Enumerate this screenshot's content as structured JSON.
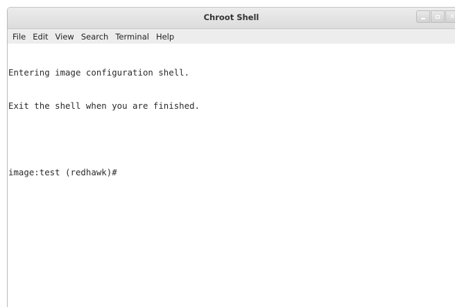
{
  "window": {
    "title": "Chroot Shell"
  },
  "menubar": {
    "items": [
      {
        "label": "File"
      },
      {
        "label": "Edit"
      },
      {
        "label": "View"
      },
      {
        "label": "Search"
      },
      {
        "label": "Terminal"
      },
      {
        "label": "Help"
      }
    ]
  },
  "terminal": {
    "lines": [
      "Entering image configuration shell.",
      "Exit the shell when you are finished.",
      "",
      "image:test (redhawk)#"
    ]
  },
  "controls": {
    "minimize_icon": "minimize-icon",
    "maximize_icon": "maximize-icon",
    "close_icon": "close-icon",
    "close_glyph": "x"
  },
  "colors": {
    "titlebar": "#e3e3e3",
    "menubar": "#ededed",
    "terminal_bg": "#ffffff",
    "terminal_fg": "#2b2b2b"
  }
}
